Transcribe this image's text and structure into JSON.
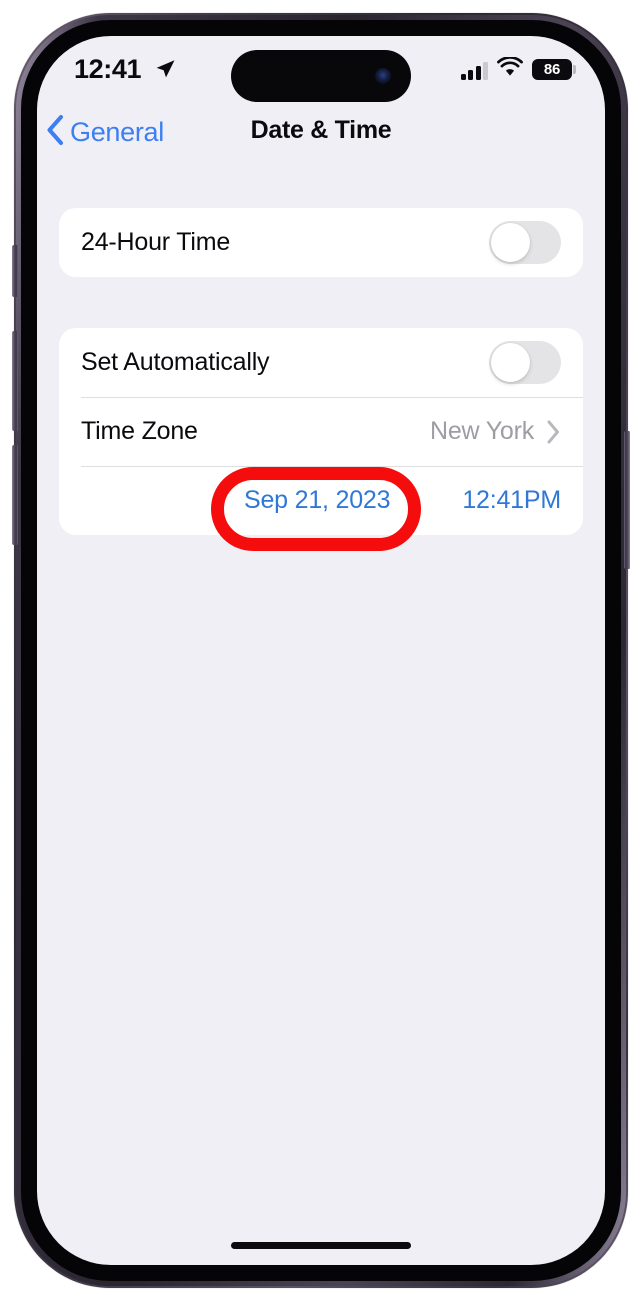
{
  "status_bar": {
    "time": "12:41",
    "location_icon": "location-arrow-icon",
    "signal_icon": "cellular-signal-icon",
    "wifi_icon": "wifi-icon",
    "battery_level": "86"
  },
  "nav_bar": {
    "back_label": "General",
    "back_icon": "chevron-left-icon",
    "title": "Date & Time"
  },
  "groups": [
    {
      "rows": [
        {
          "label": "24-Hour Time",
          "control": "toggle",
          "toggle_on": false
        }
      ]
    },
    {
      "rows": [
        {
          "label": "Set Automatically",
          "control": "toggle",
          "toggle_on": false
        },
        {
          "label": "Time Zone",
          "value": "New York",
          "control": "disclosure",
          "disclosure_icon": "chevron-right-icon"
        },
        {
          "date_value": "Sep 21, 2023",
          "time_value": "12:41PM"
        }
      ]
    }
  ],
  "annotation": {
    "shape": "ellipse-outline",
    "color": "#f50d0d",
    "targets": "Sep 21, 2023"
  },
  "colors": {
    "accent_blue": "#3b7ff2",
    "picker_blue": "#2f78d8",
    "value_gray": "#9d9da3",
    "screen_background": "#f0eff5",
    "card_background": "#ffffff",
    "annotation_red": "#f50d0d"
  }
}
